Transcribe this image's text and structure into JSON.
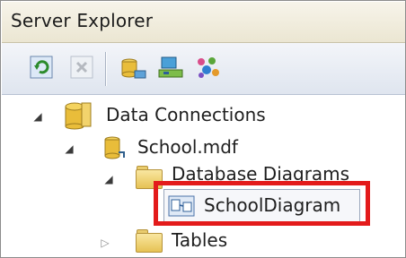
{
  "window": {
    "title": "Server Explorer"
  },
  "toolbar": {
    "buttons": [
      {
        "icon": "refresh-icon"
      },
      {
        "icon": "stop-refresh-icon"
      },
      {
        "icon": "connect-to-database-icon"
      },
      {
        "icon": "connect-to-server-icon"
      },
      {
        "icon": "connect-to-sharepoint-icon"
      }
    ]
  },
  "tree": {
    "data_connections": {
      "label": "Data Connections",
      "expanded": true
    },
    "school_db": {
      "label": "School.mdf",
      "expanded": true
    },
    "database_diagrams": {
      "label": "Database Diagrams",
      "expanded": true
    },
    "school_diagram": {
      "label": "SchoolDiagram",
      "selected": true
    },
    "tables": {
      "label": "Tables",
      "expanded": false
    }
  },
  "colors": {
    "highlight_border": "#e31b1b",
    "folder": "#e6c254"
  }
}
